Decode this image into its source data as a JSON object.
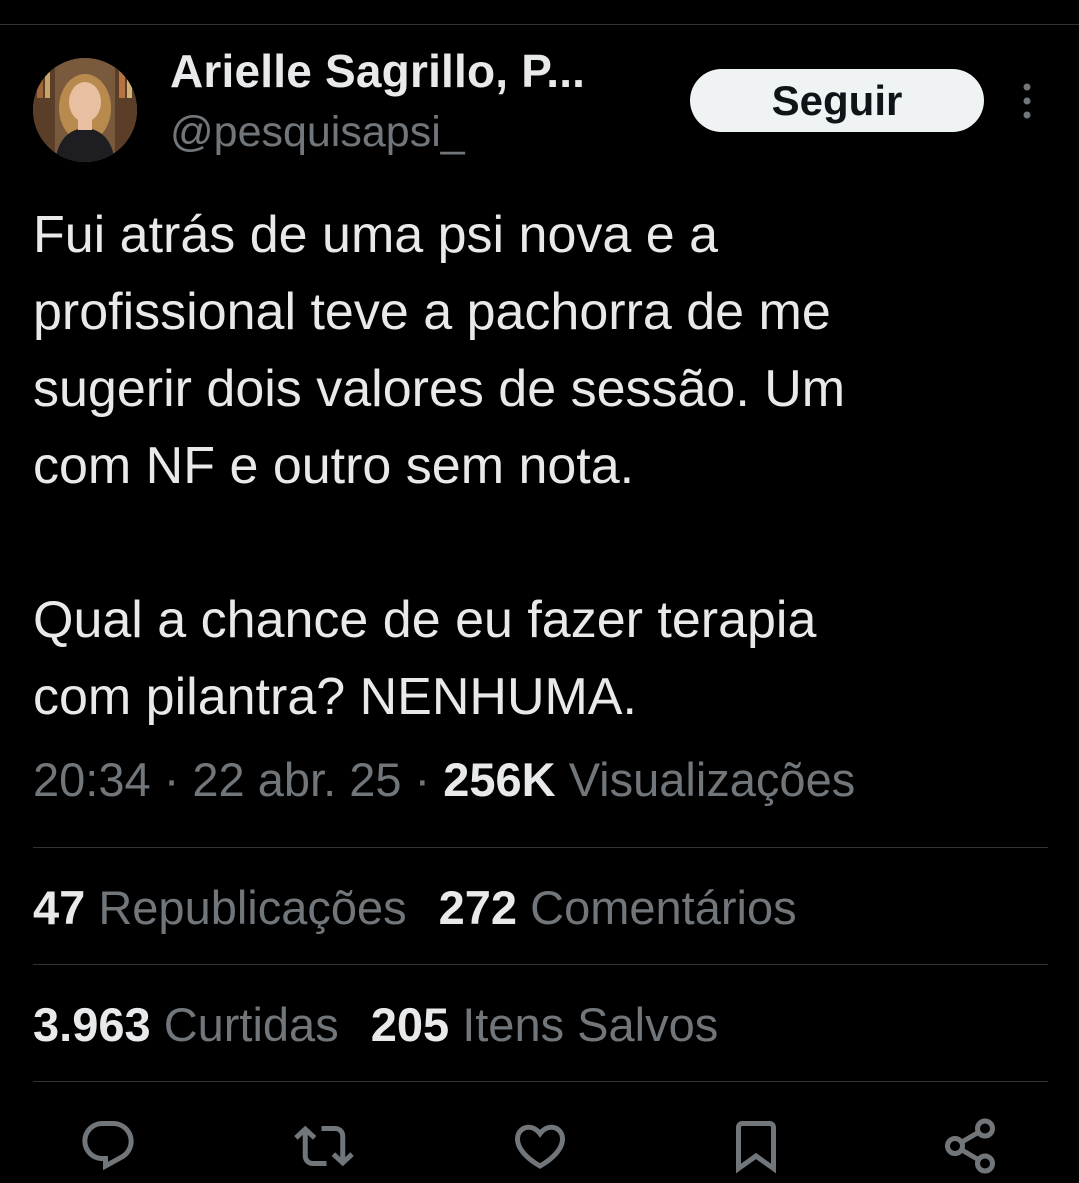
{
  "author": {
    "name": "Arielle Sagrillo, P...",
    "handle": "@pesquisapsi_"
  },
  "follow_label": "Seguir",
  "tweet": {
    "text": "Fui atrás de uma psi nova e a\nprofissional teve a pachorra de me\nsugerir dois valores de sessão. Um\ncom NF e outro sem nota.\n\nQual a chance de eu fazer terapia\ncom pilantra? NENHUMA."
  },
  "meta": {
    "time": "20:34",
    "separator": "·",
    "date": "22 abr. 25",
    "views_count": "256K",
    "views_label": "Visualizações"
  },
  "stats": {
    "reposts_count": "47",
    "reposts_label": "Republicações",
    "comments_count": "272",
    "comments_label": "Comentários",
    "likes_count": "3.963",
    "likes_label": "Curtidas",
    "saves_count": "205",
    "saves_label": "Itens Salvos"
  },
  "actions": [
    "reply-icon",
    "repost-icon",
    "like-icon",
    "bookmark-icon",
    "share-icon"
  ],
  "colors": {
    "background": "#000000",
    "text_primary": "#e7e9ea",
    "text_secondary": "#71767b",
    "divider": "#2f3336",
    "button_bg": "#eff3f4",
    "button_text": "#0f1419"
  }
}
